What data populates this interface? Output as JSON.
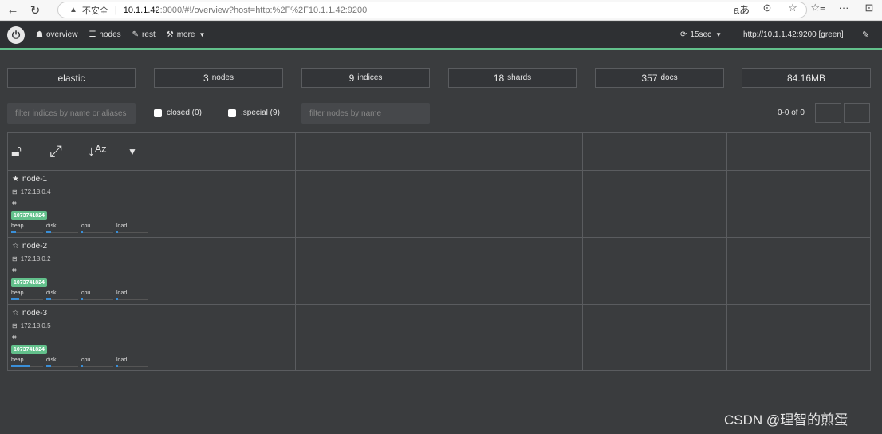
{
  "browser": {
    "warning": "▲",
    "security_label": "不安全",
    "url_host": "10.1.1.42",
    "url_rest": ":9000/#!/overview?host=http:%2F%2F10.1.1.42:9200"
  },
  "topbar": {
    "overview": "overview",
    "nodes": "nodes",
    "rest": "rest",
    "more": "more",
    "refresh": "15sec",
    "host": "http://10.1.1.42:9200 [green]"
  },
  "stats": {
    "cluster": "elastic",
    "nodes_count": "3",
    "nodes_unit": "nodes",
    "indices_count": "9",
    "indices_unit": "indices",
    "shards_count": "18",
    "shards_unit": "shards",
    "docs_count": "357",
    "docs_unit": "docs",
    "size": "84.16MB"
  },
  "filters": {
    "indices_placeholder": "filter indices by name or aliases",
    "closed_label": "closed (0)",
    "special_label": ".special (9)",
    "nodes_placeholder": "filter nodes by name",
    "pager": "0-0 of 0"
  },
  "nodes": [
    {
      "name": "node-1",
      "ip": "172.18.0.4",
      "badge": "1073741824",
      "master": true,
      "heap": 0.16,
      "disk": 0.15,
      "cpu": 0.03,
      "load": 0.05
    },
    {
      "name": "node-2",
      "ip": "172.18.0.2",
      "badge": "1073741824",
      "master": false,
      "heap": 0.26,
      "disk": 0.15,
      "cpu": 0.03,
      "load": 0.05
    },
    {
      "name": "node-3",
      "ip": "172.18.0.5",
      "badge": "1073741824",
      "master": false,
      "heap": 0.58,
      "disk": 0.15,
      "cpu": 0.03,
      "load": 0.05
    }
  ],
  "metric_labels": {
    "heap": "heap",
    "disk": "disk",
    "cpu": "cpu",
    "load": "load"
  },
  "watermark": "CSDN @理智的煎蛋",
  "colors": {
    "accent": "#62c08b",
    "bar": "#3a8fd8",
    "background": "#3a3c3e"
  }
}
